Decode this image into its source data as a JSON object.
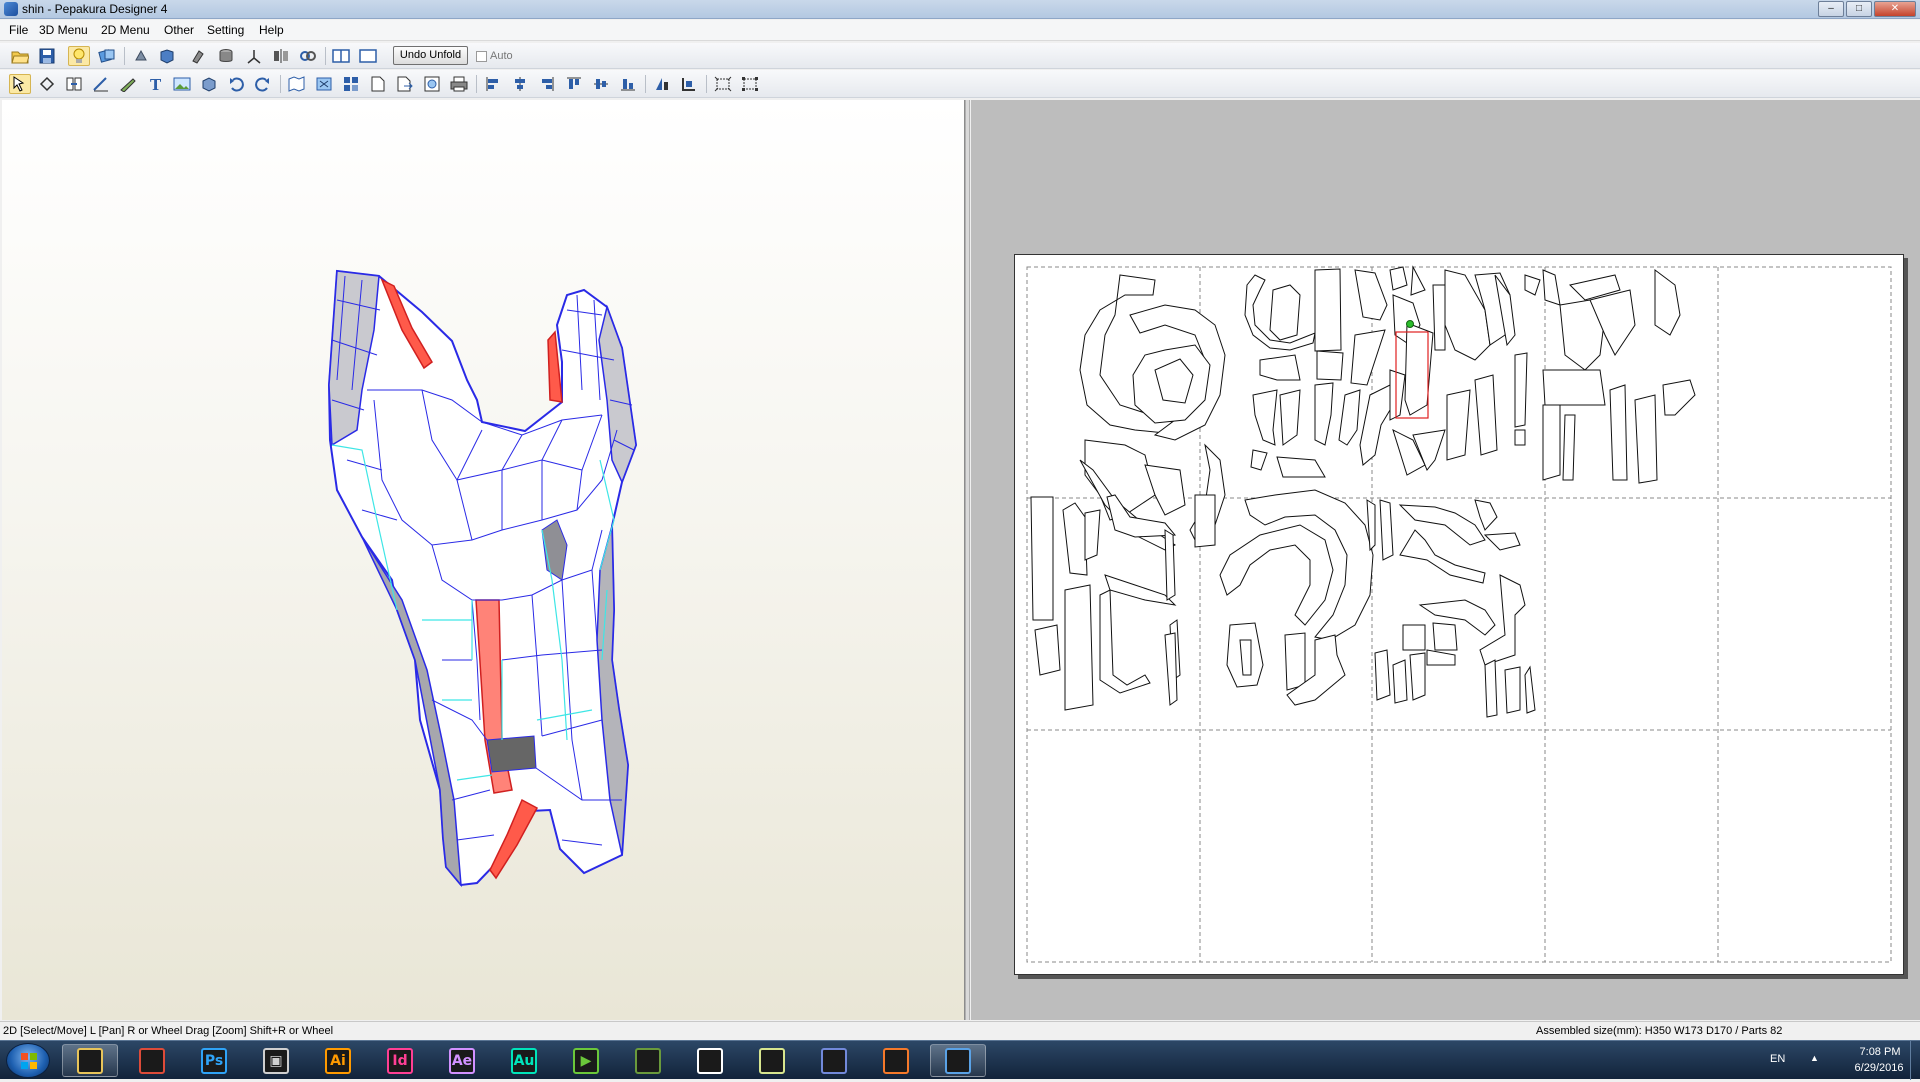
{
  "window": {
    "title": "shin - Pepakura Designer 4",
    "controls": {
      "minimize": "–",
      "maximize": "□",
      "close": "✕"
    }
  },
  "menu": [
    "File",
    "3D Menu",
    "2D Menu",
    "Other",
    "Setting",
    "Help"
  ],
  "toolbar1": {
    "undo_unfold_label": "Undo Unfold",
    "auto_label": "Auto",
    "auto_checked": false
  },
  "status": {
    "hint": "2D [Select/Move] L [Pan] R or Wheel Drag [Zoom] Shift+R or Wheel",
    "assembled": "Assembled size(mm): H350 W173 D170 / Parts 82"
  },
  "taskbar": {
    "apps": [
      {
        "name": "file-explorer",
        "label": "",
        "color": "#e8c45a"
      },
      {
        "name": "chrome",
        "label": "",
        "color": "#dd4b39"
      },
      {
        "name": "photoshop",
        "label": "Ps",
        "color": "#2fa3f7"
      },
      {
        "name": "video-editor",
        "label": "▣",
        "color": "#cfcfcf"
      },
      {
        "name": "illustrator",
        "label": "Ai",
        "color": "#ff9a00"
      },
      {
        "name": "indesign",
        "label": "Id",
        "color": "#ff3f94"
      },
      {
        "name": "after-effects",
        "label": "Ae",
        "color": "#d291ff"
      },
      {
        "name": "audition",
        "label": "Au",
        "color": "#00e4bb"
      },
      {
        "name": "media-player",
        "label": "▶",
        "color": "#6bc73a"
      },
      {
        "name": "minecraft",
        "label": "",
        "color": "#6a9a3c"
      },
      {
        "name": "fox-app",
        "label": "",
        "color": "#ffffff"
      },
      {
        "name": "folder-app",
        "label": "",
        "color": "#d7e58e"
      },
      {
        "name": "discord",
        "label": "",
        "color": "#7289da"
      },
      {
        "name": "blender",
        "label": "",
        "color": "#f5792a"
      },
      {
        "name": "pepakura",
        "label": "",
        "color": "#5aa2e6"
      }
    ],
    "tray": {
      "language": "EN",
      "time": "7:08 PM",
      "date": "6/29/2016"
    }
  }
}
